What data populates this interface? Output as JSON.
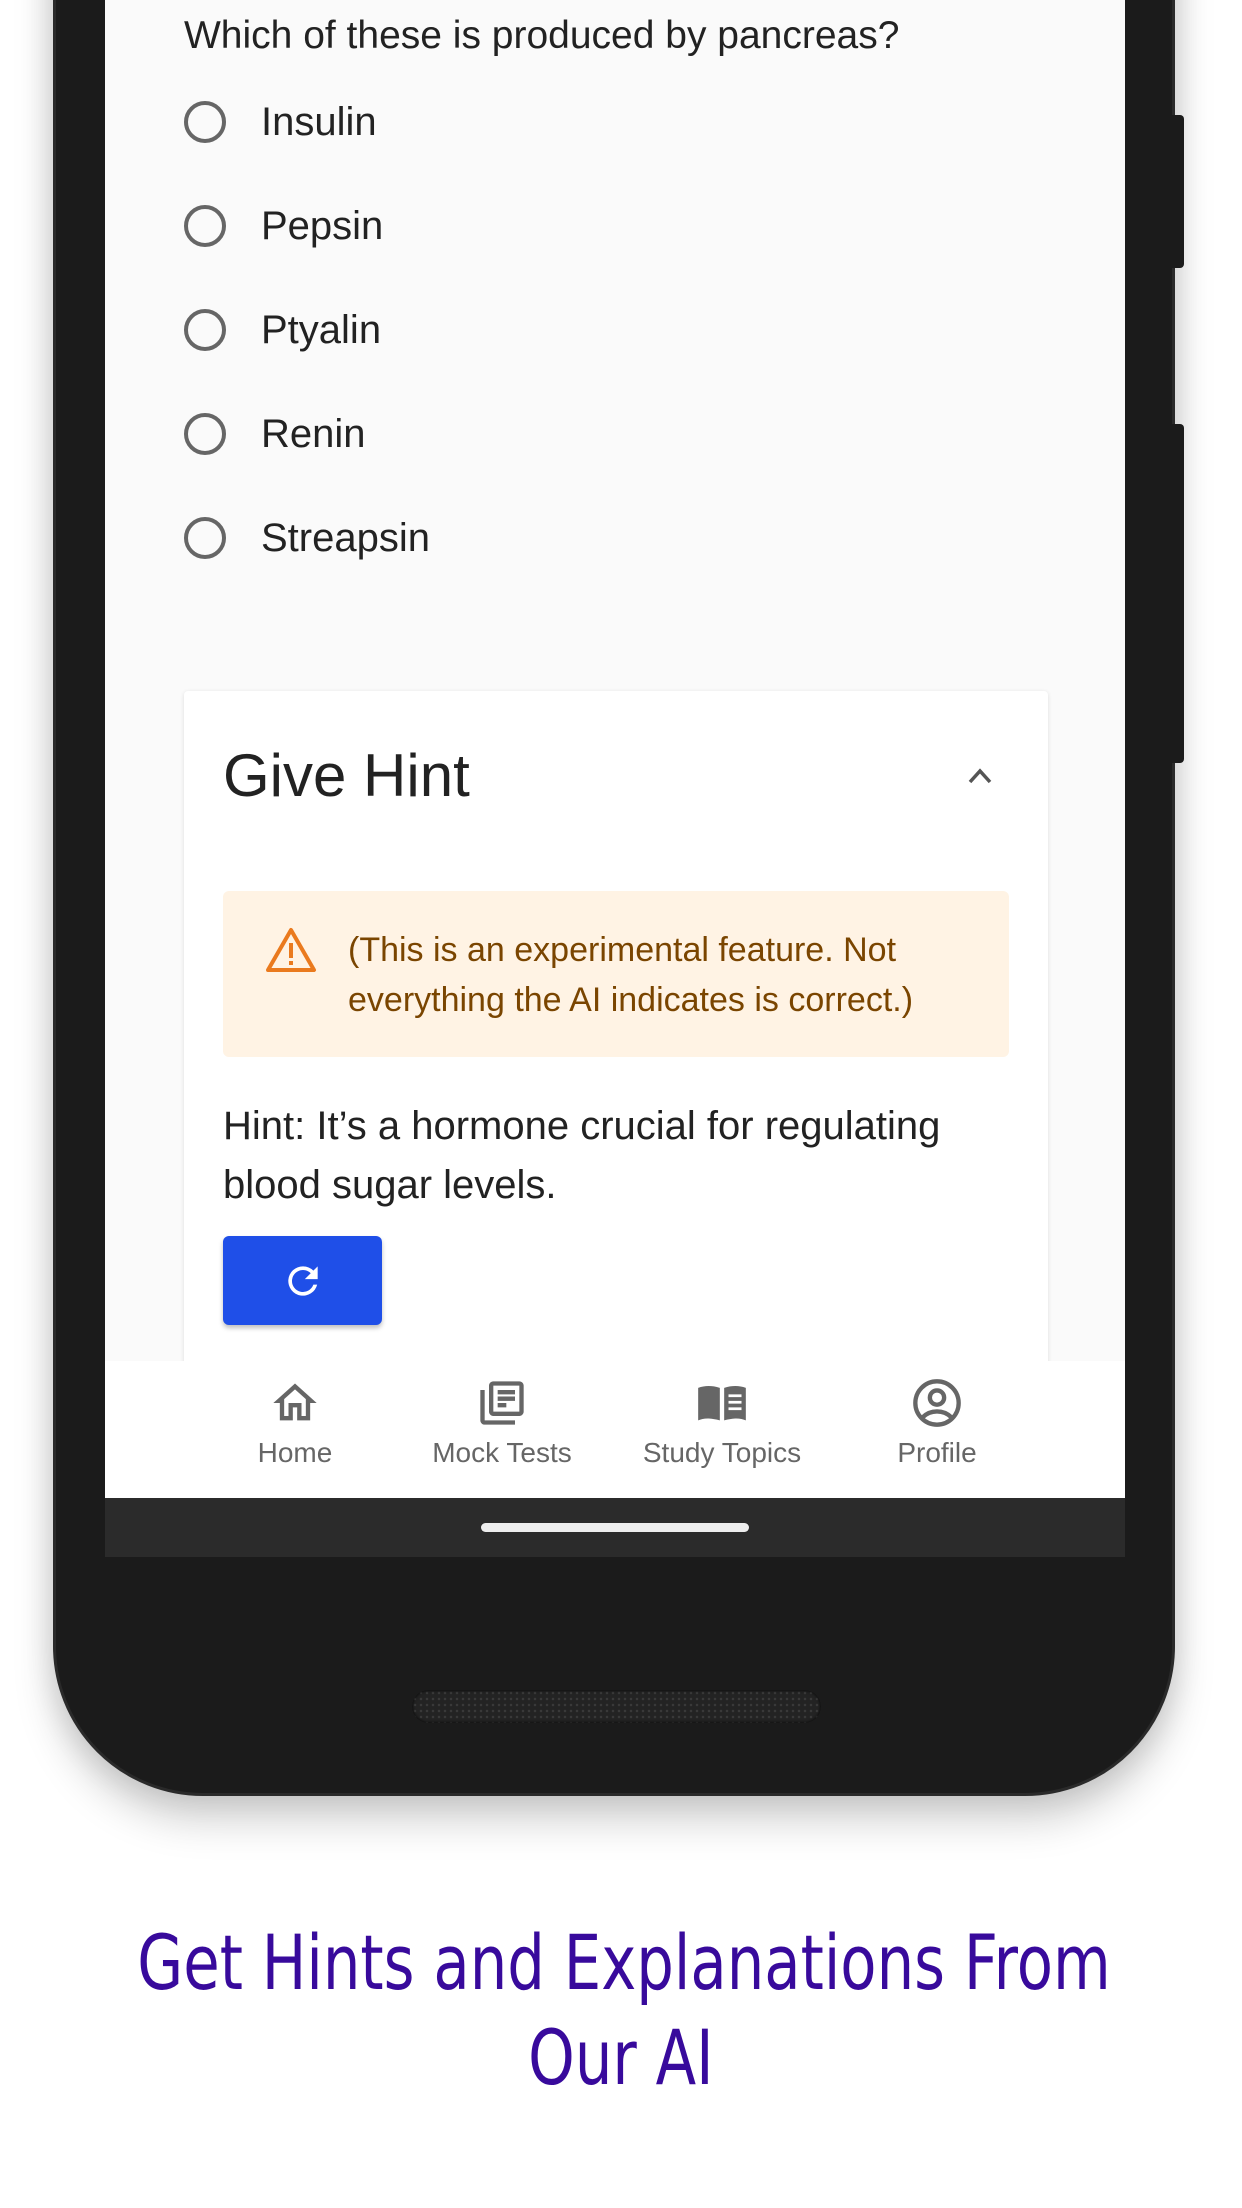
{
  "question": {
    "text": "Which of these is produced by pancreas?",
    "options": [
      "Insulin",
      "Pepsin",
      "Ptyalin",
      "Renin",
      "Streapsin"
    ]
  },
  "hint_card": {
    "title": "Give Hint",
    "expanded": true,
    "warning": "(This is an experimental feature. Not everything the AI indicates is correct.)",
    "hint_text": "Hint: It’s a hormone crucial for regulating blood sugar levels.",
    "refresh_icon": "refresh-icon"
  },
  "bottom_nav": {
    "items": [
      {
        "label": "Home",
        "icon": "home-icon"
      },
      {
        "label": "Mock Tests",
        "icon": "newspaper-icon"
      },
      {
        "label": "Study Topics",
        "icon": "book-icon"
      },
      {
        "label": "Profile",
        "icon": "user-circle-icon"
      }
    ]
  },
  "caption": {
    "line1": "Get Hints and Explanations From",
    "line2": "Our AI"
  },
  "colors": {
    "primary_button": "#1f4fe8",
    "warning_bg": "#fff3e4",
    "warning_icon": "#ea7a1e",
    "caption": "#380a9c"
  }
}
